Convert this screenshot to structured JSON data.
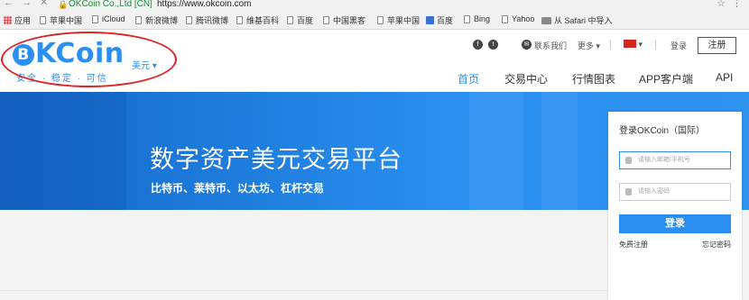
{
  "browser": {
    "secure_label": "OKCoin Co.,Ltd [CN]",
    "url": "https://www.okcoin.com"
  },
  "bookmarks": [
    {
      "label": "应用"
    },
    {
      "label": "苹果中国"
    },
    {
      "label": "iCloud"
    },
    {
      "label": "新浪微博"
    },
    {
      "label": "腾讯微博"
    },
    {
      "label": "维基百科"
    },
    {
      "label": "百度"
    },
    {
      "label": "中国黑客"
    },
    {
      "label": "苹果中国"
    },
    {
      "label": "百度"
    },
    {
      "label": "Bing"
    },
    {
      "label": "Yahoo"
    },
    {
      "label": "从 Safari 中导入"
    }
  ],
  "header": {
    "logo_text": "KCoin",
    "logo_letter": "B",
    "tagline": "安全 · 稳定 · 可信",
    "currency": "美元 ▾",
    "contact": "联系我们",
    "more": "更多 ▾",
    "login": "登录",
    "register": "注册",
    "nav": [
      "首页",
      "交易中心",
      "行情图表",
      "APP客户端",
      "API"
    ]
  },
  "hero": {
    "title": "数字资产美元交易平台",
    "subtitle": "比特币、莱特币、以太坊、杠杆交易"
  },
  "login_box": {
    "title": "登录OKCoin（国际）",
    "username_placeholder": "请输入邮箱/手机号",
    "password_placeholder": "请输入密码",
    "button": "登录",
    "free_register": "免费注册",
    "forgot": "忘记密码"
  },
  "colors": {
    "brand": "#2a8ff0",
    "annotation_oval": "#e02424"
  }
}
